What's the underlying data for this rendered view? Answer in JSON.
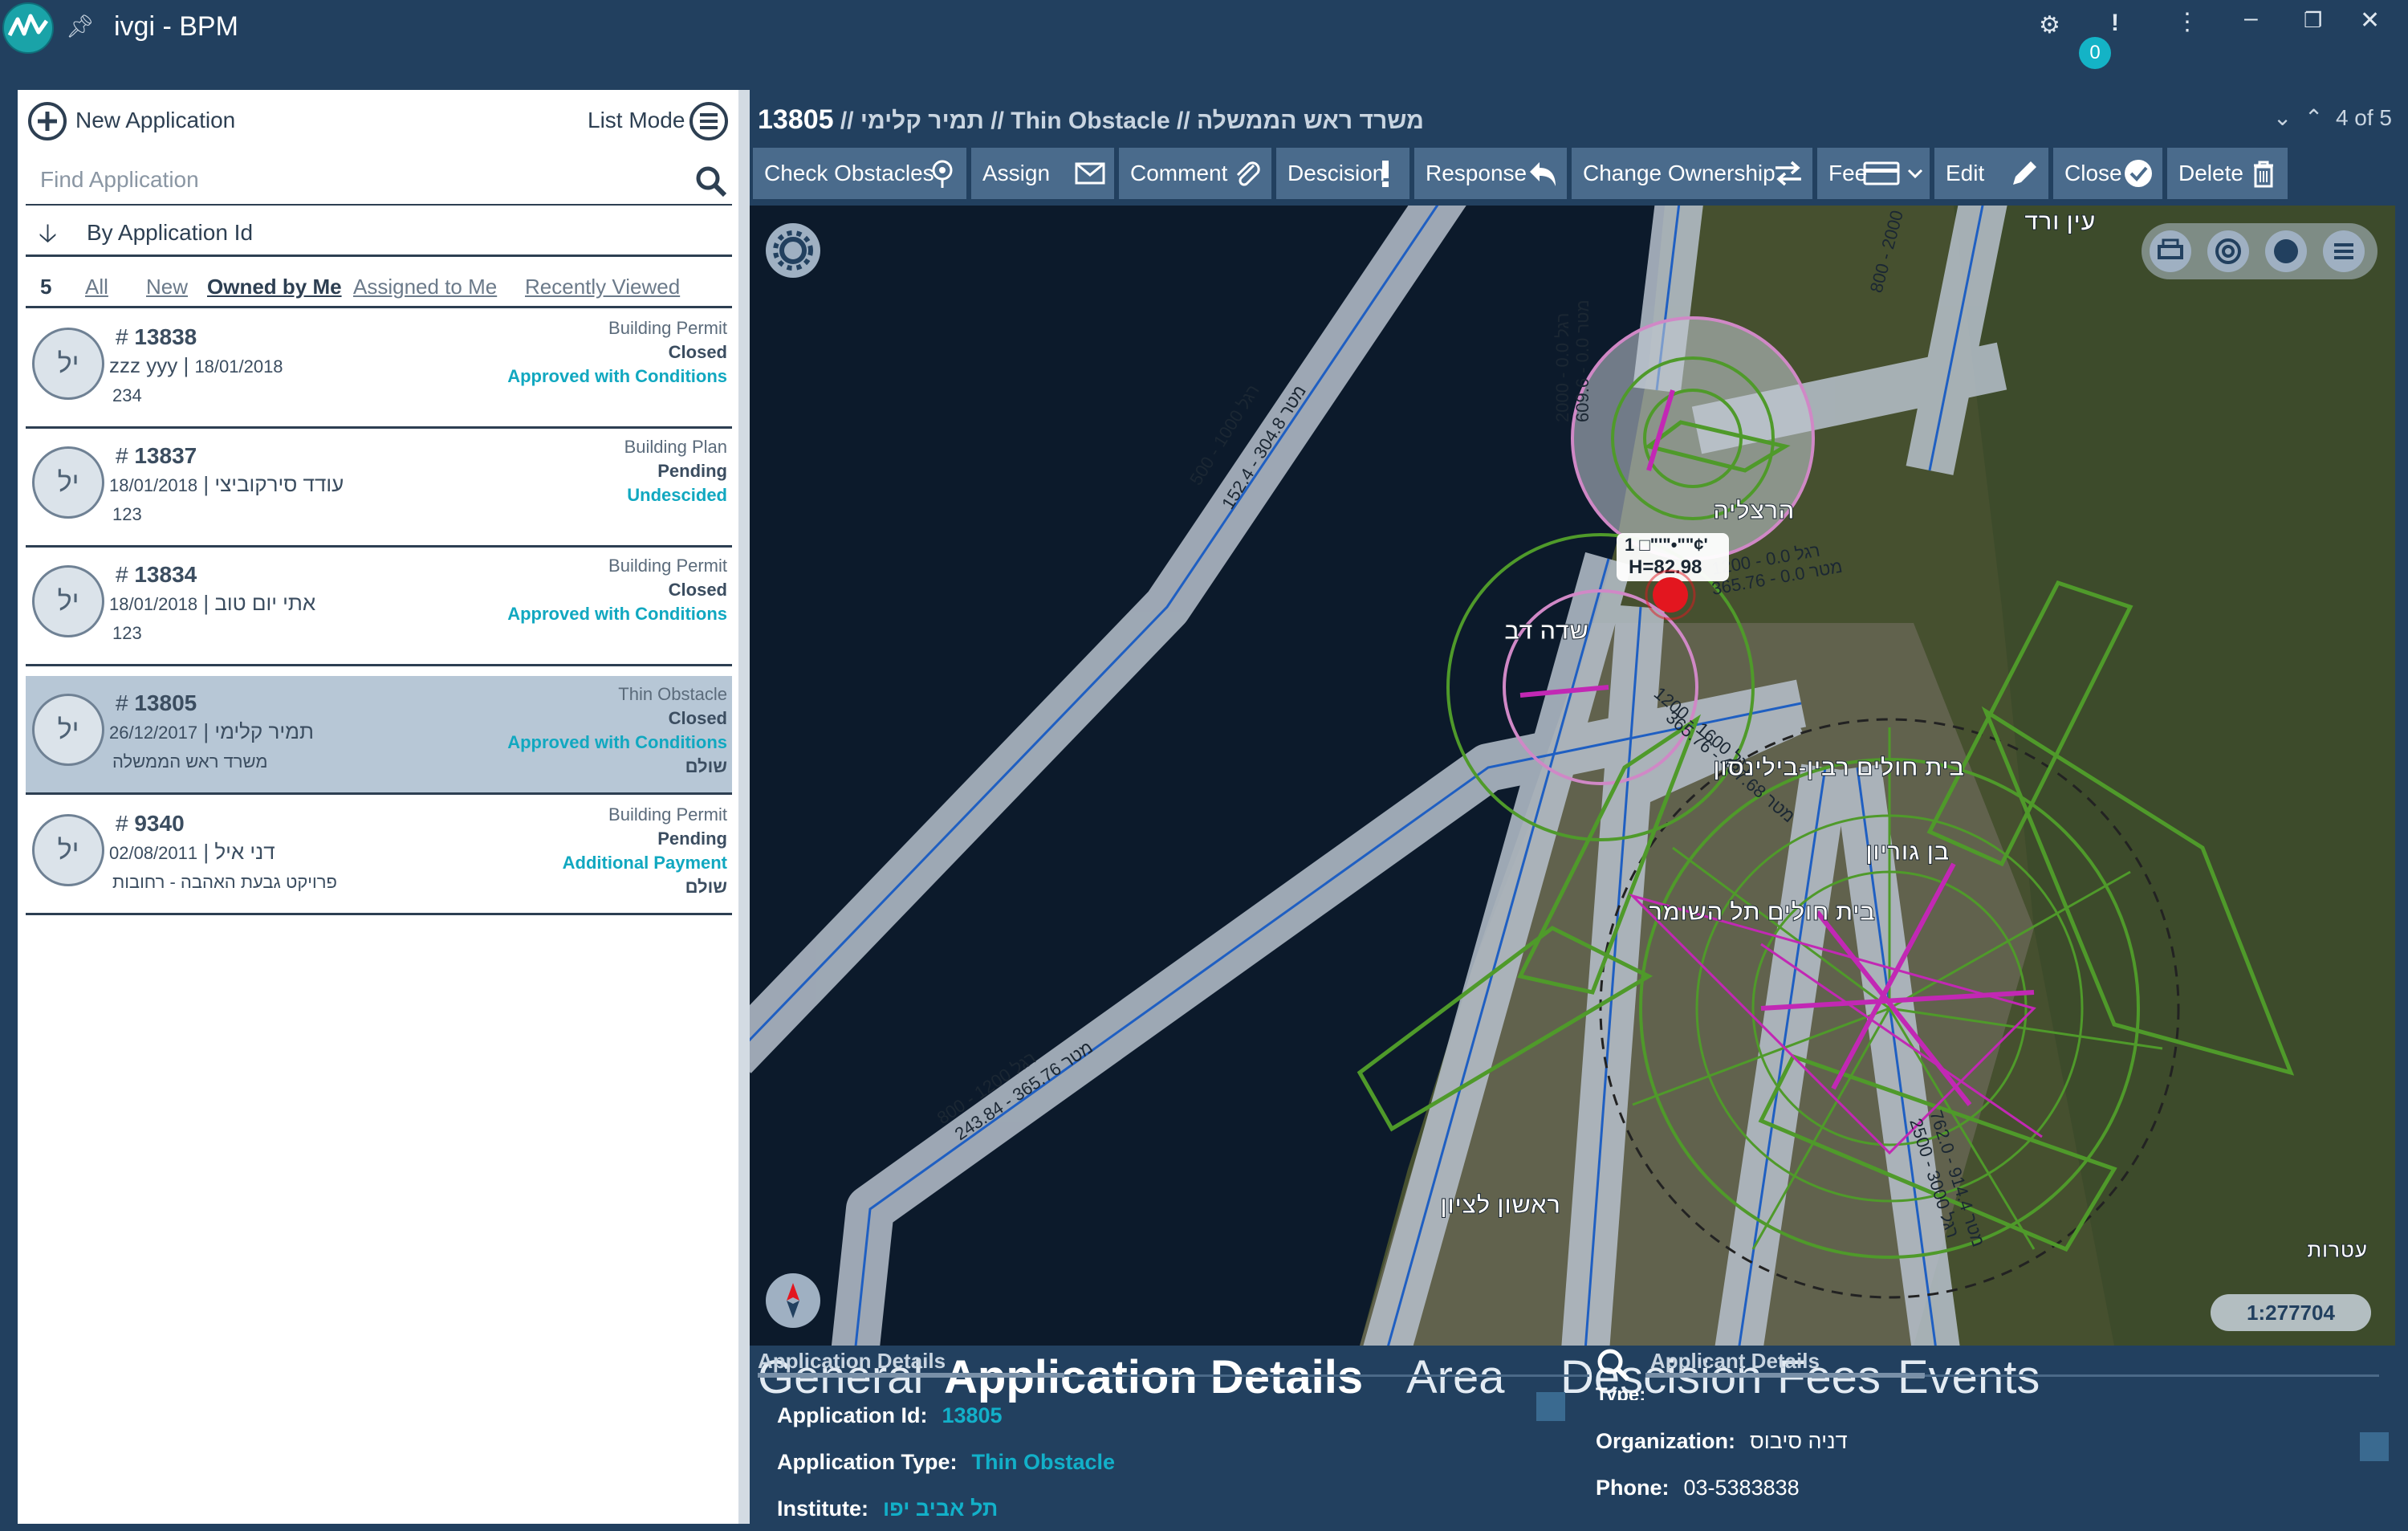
{
  "window": {
    "title": "ivgi - BPM",
    "notifications_count": "0"
  },
  "left_panel": {
    "new_application_label": "New Application",
    "list_mode_label": "List Mode",
    "search": {
      "placeholder": "Find Application",
      "value": ""
    },
    "sort_label": "By Application Id",
    "filters": {
      "count": "5",
      "items": [
        "All",
        "New",
        "Owned by Me",
        "Assigned to Me",
        "Recently Viewed"
      ],
      "active": "Owned by Me"
    },
    "applications": [
      {
        "id": "13838",
        "avatar": "יל",
        "person": "zzz yyy",
        "date": "18/01/2018",
        "sub": "234",
        "type": "Building Permit",
        "status": "Closed",
        "decision": "Approved with Conditions",
        "extra": ""
      },
      {
        "id": "13837",
        "avatar": "יל",
        "person": "עודד סירקוביצי",
        "date": "18/01/2018",
        "sub": "123",
        "type": "Building Plan",
        "status": "Pending",
        "decision": "Undescided",
        "extra": ""
      },
      {
        "id": "13834",
        "avatar": "יל",
        "person": "אתי יום טוב",
        "date": "18/01/2018",
        "sub": "123",
        "type": "Building Permit",
        "status": "Closed",
        "decision": "Approved with Conditions",
        "extra": ""
      },
      {
        "id": "13805",
        "avatar": "יל",
        "person": "תמיר קלימי",
        "date": "26/12/2017",
        "sub": "משרד ראש הממשלה",
        "type": "Thin Obstacle",
        "status": "Closed",
        "decision": "Approved with Conditions",
        "extra": "שולם"
      },
      {
        "id": "9340",
        "avatar": "יל",
        "person": "דני איל",
        "date": "02/08/2011",
        "sub": "פרויקט גבעת האהבה - רחובות",
        "type": "Building Permit",
        "status": "Pending",
        "decision": "Additional Payment",
        "extra": "שולם"
      }
    ]
  },
  "detail": {
    "breadcrumb": {
      "id": "13805",
      "person": "תמיר קלימי",
      "type": "Thin Obstacle",
      "org": "משרד ראש הממשלה"
    },
    "pager": "4 of 5",
    "toolbar": [
      "Check Obstacles",
      "Assign",
      "Comment",
      "Descision",
      "Response",
      "Change Ownership",
      "Fee",
      "Edit",
      "Close",
      "Delete"
    ],
    "map": {
      "scale": "1:277704",
      "marker_label_line1": "1 □\"'\"•\"\"¢'",
      "marker_label_line2": "H=82.98",
      "place_labels": [
        "עין ורד",
        "הרצליה",
        "שדה דב",
        "בית חולים רבין-בילינסון",
        "בן גוריון",
        "בית חולים תל השומר",
        "ראשון לציון",
        "עטרות"
      ],
      "zone_labels": {
        "a": "500 - 1000 רגל",
        "b": "מטר 304.8 - 152.4",
        "c": "800 - 1200 רגל",
        "d": "מטר 365.76 - 243.84",
        "e": "1200 - 1600 רגל",
        "f": "מטר 487.68 - 365.76",
        "g": "1200 - 0.0 רגל",
        "h": "מטר 0.0 - 365.76",
        "i": "800 - 2000",
        "j": "2500 - 3000 רגל",
        "k": "מטר 914.4 - 762.0",
        "l": "2000 - 0.0 רגל",
        "m": "מטר 0.0 - 609.6"
      }
    },
    "tabs": [
      "General",
      "Application Details",
      "Area",
      "Descision",
      "Fees",
      "Events"
    ],
    "active_tab": "Application Details",
    "application_details": {
      "title": "Application Details",
      "id_label": "Application Id:",
      "id_value": "13805",
      "type_label": "Application Type:",
      "type_value": "Thin Obstacle",
      "institute_label": "Institute:",
      "institute_value": "תל אביב יפו"
    },
    "applicant_details": {
      "title": "Applicant Details",
      "type_label": "Type:",
      "org_label": "Organization:",
      "org_value": "דניה סיבוס",
      "phone_label": "Phone:",
      "phone_value": "03-5383838"
    }
  },
  "colors": {
    "titlebar": "#22405f",
    "accent": "#12b0c9",
    "toolbar_button": "#4a6b8c",
    "selected_row": "#b7c7d6",
    "zone_green": "#4f9a2a",
    "zone_magenta": "#c228b4"
  }
}
